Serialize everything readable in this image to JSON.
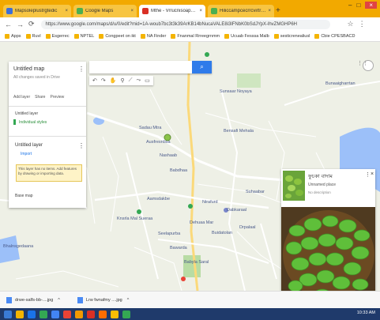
{
  "browser": {
    "tabs": [
      {
        "label": "Mapsoleplustrgtedic",
        "color": "#3d6fd8"
      },
      {
        "label": "Coogle Maps",
        "color": "#4caf50"
      },
      {
        "label": "Mthe - Vrrucnisoaphafrasra",
        "color": "#d93025"
      },
      {
        "label": "Hiliccampcecrrcvirtrirahe",
        "color": "#4caf50"
      }
    ],
    "new_tab": "+",
    "window_controls": [
      "–",
      "□",
      "×"
    ],
    "url": "https://www.google.com/maps/d/u/0/edit?mid=1A-woub7bc3t3k39ArKB14bNucaVALE8i3lFNbK0bSdJYpX-lhvZMGHP6H",
    "bookmarks": [
      "Apps",
      "Ruvl",
      "Esgerrec",
      "NPTEL",
      "Congpeet on ikt",
      "NA Finder",
      "Fnanmal Rrreegrnmm",
      "Ucuab Fesssa Malb",
      "sesticrenealiusl",
      "Cbie CPESBACD"
    ]
  },
  "map": {
    "search_button_icon": "search-icon",
    "tool_icons": [
      "undo-icon",
      "redo-icon",
      "hand-icon",
      "marker-icon",
      "line-icon",
      "route-icon",
      "ruler-icon"
    ],
    "places": [
      "Dabbaasrwea",
      "Sunsaar Noyaya",
      "Sadau Mtra",
      "Ausfresnbsa",
      "Bensafi Mehala",
      "Nashaab",
      "Babdhaa",
      "Aamsdakbe",
      "Nirafurd",
      "Dabkaraal",
      "Suhaabar",
      "Knsrla Mal Sueraa",
      "Seelapurba",
      "Dehuaa Mar",
      "Buidatolan",
      "Bhalnsgedaana",
      "Bawarda",
      "Babyla Saral",
      "Drpalaal",
      "Bunaaigharrtan"
    ],
    "panel": {
      "title": "Untitled map",
      "subtitle": "All changes saved in Drive",
      "links": [
        "Add layer",
        "Share",
        "Preview"
      ],
      "layer_title": "Untitled layer",
      "layer_style": "Individual styles",
      "layer2_title": "Untitled layer",
      "layer2_sub": "Import",
      "note": "This layer has no items. Add features by drawing or importing data.",
      "basemap": "Base map"
    },
    "card": {
      "title": "ফুচকা বাদাম",
      "subtitle": "Unnamed place",
      "meta": "No description",
      "more_icon": "more-vert-icon",
      "close_icon": "close-icon"
    }
  },
  "downloads": [
    {
      "name": "drwe-salfs-bb-....jpg"
    },
    {
      "name": "Lrw fwnafmy ....jpg"
    }
  ],
  "taskbar": {
    "icons": [
      "#3a7bd5",
      "#f4b400",
      "#1a73e8",
      "#34a853",
      "#4285f4",
      "#ea4335",
      "#f29900",
      "#d93025",
      "#ff6d00",
      "#fbbc04",
      "#34a853"
    ],
    "clock": "10:33 AM"
  }
}
